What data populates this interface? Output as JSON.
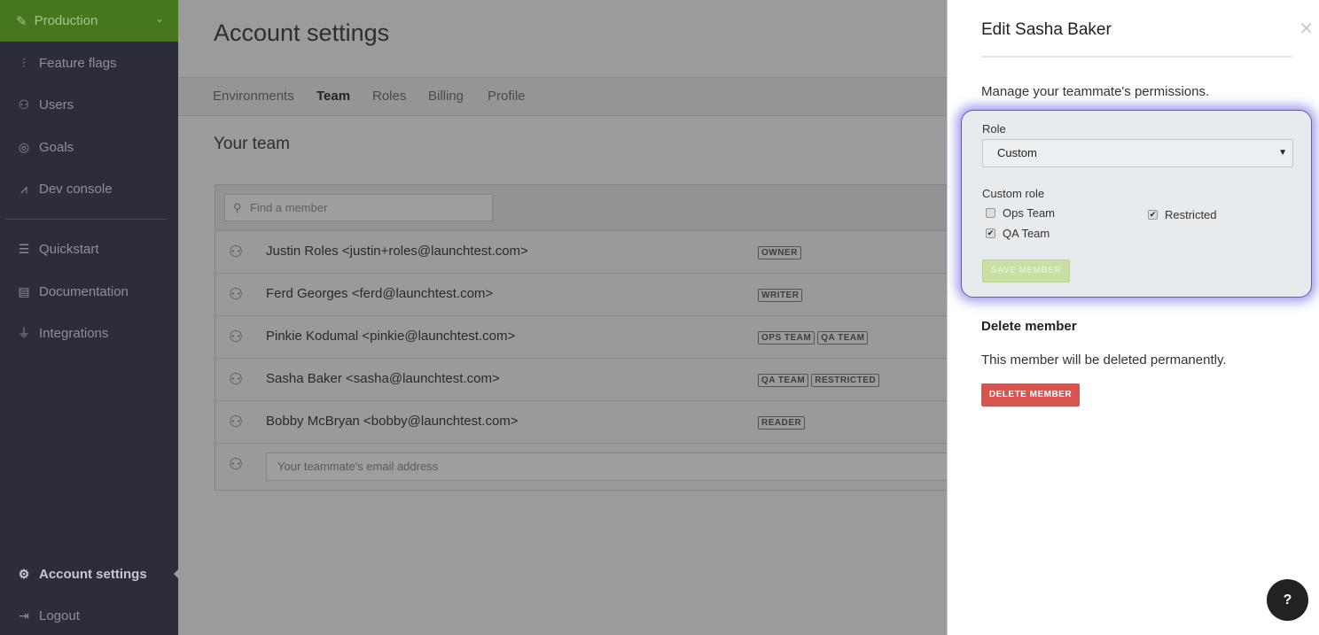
{
  "sidebar": {
    "environment": "Production",
    "items": [
      {
        "label": "Feature flags",
        "icon": "sliders-icon"
      },
      {
        "label": "Users",
        "icon": "users-icon"
      },
      {
        "label": "Goals",
        "icon": "target-icon"
      },
      {
        "label": "Dev console",
        "icon": "pulse-icon"
      },
      {
        "label": "Quickstart",
        "icon": "signpost-icon"
      },
      {
        "label": "Documentation",
        "icon": "book-icon"
      },
      {
        "label": "Integrations",
        "icon": "plug-icon"
      }
    ],
    "bottom": [
      {
        "label": "Account settings",
        "icon": "gear-icon",
        "active": true
      },
      {
        "label": "Logout",
        "icon": "logout-icon"
      }
    ]
  },
  "main": {
    "title": "Account settings",
    "tabs": [
      "Environments",
      "Team",
      "Roles",
      "Billing",
      "Profile"
    ],
    "active_tab": "Team",
    "section_title": "Your team",
    "search_placeholder": "Find a member",
    "members": [
      {
        "name": "Justin Roles <justin+roles@launchtest.com>",
        "badges": [
          "OWNER"
        ]
      },
      {
        "name": "Ferd Georges <ferd@launchtest.com>",
        "badges": [
          "WRITER"
        ]
      },
      {
        "name": "Pinkie Kodumal <pinkie@launchtest.com>",
        "badges": [
          "OPS TEAM",
          "QA TEAM"
        ]
      },
      {
        "name": "Sasha Baker <sasha@launchtest.com>",
        "badges": [
          "QA TEAM",
          "RESTRICTED"
        ]
      },
      {
        "name": "Bobby McBryan <bobby@launchtest.com>",
        "badges": [
          "READER"
        ]
      }
    ],
    "invite_placeholder": "Your teammate's email address"
  },
  "panel": {
    "title": "Edit Sasha Baker",
    "description": "Manage your teammate's permissions.",
    "role_label": "Role",
    "role_value": "Custom",
    "custom_role_label": "Custom role",
    "custom_roles": [
      {
        "label": "Ops Team",
        "checked": false
      },
      {
        "label": "QA Team",
        "checked": true
      },
      {
        "label": "Restricted",
        "checked": true
      }
    ],
    "save_label": "SAVE MEMBER",
    "delete_heading": "Delete member",
    "delete_text": "This member will be deleted permanently.",
    "delete_label": "DELETE MEMBER"
  },
  "colors": {
    "environment": "#47771d",
    "sidebar": "#2d2c3a",
    "delete": "#d9534f",
    "focus_glow": "#5f5fdc"
  }
}
